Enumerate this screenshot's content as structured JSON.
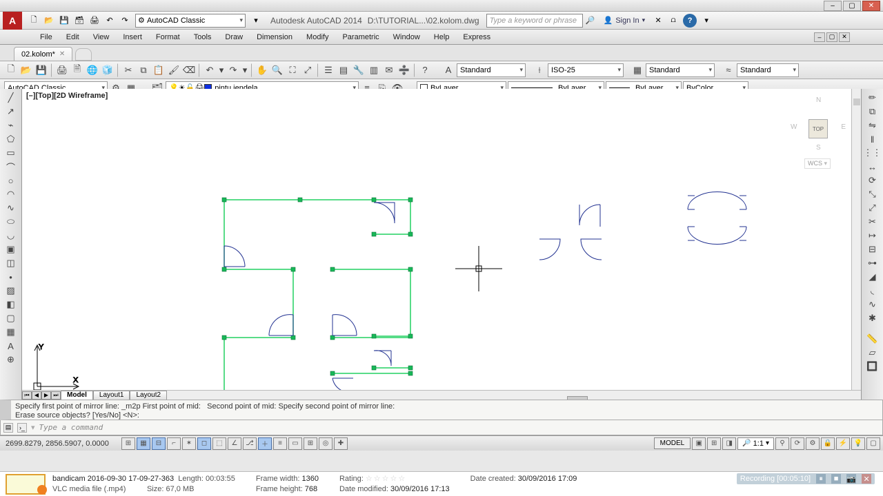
{
  "window": {
    "app_title": "Autodesk AutoCAD 2014",
    "file_title": "D:\\TUTORIAL...\\02.kolom.dwg",
    "search_placeholder": "Type a keyword or phrase",
    "signin": "Sign In"
  },
  "workspace": {
    "current": "AutoCAD Classic",
    "current2": "AutoCAD Classic"
  },
  "menu": [
    "File",
    "Edit",
    "View",
    "Insert",
    "Format",
    "Tools",
    "Draw",
    "Dimension",
    "Modify",
    "Parametric",
    "Window",
    "Help",
    "Express"
  ],
  "doc_tab": {
    "name": "02.kolom*"
  },
  "styles": {
    "text": "Standard",
    "dim": "ISO-25",
    "table": "Standard",
    "ml": "Standard"
  },
  "layer": {
    "current": "pintu jendela",
    "color": "#1030e0"
  },
  "props": {
    "color": "ByLayer",
    "linetype": "ByLayer",
    "lineweight": "ByLayer",
    "plot": "ByColor"
  },
  "viewport": {
    "label": "[–][Top][2D Wireframe]",
    "cube_face": "TOP",
    "cube_dirs": {
      "n": "N",
      "s": "S",
      "e": "E",
      "w": "W"
    },
    "wcs": "WCS"
  },
  "layout_tabs": {
    "model": "Model",
    "l1": "Layout1",
    "l2": "Layout2"
  },
  "command": {
    "hist1": "Specify first point of mirror line: _m2p First point of mid:   Second point of mid: Specify second point of mirror line:",
    "hist2": "Erase source objects? [Yes/No] <N>:",
    "placeholder": "Type a command"
  },
  "status": {
    "coords": "2699.8279, 2856.5907, 0.0000",
    "model": "MODEL",
    "scale": "1:1"
  },
  "explorer": {
    "filename": "bandicam 2016-09-30 17-09-27-363",
    "type": "VLC media file (.mp4)",
    "length_label": "Length:",
    "length": "00:03:55",
    "size_label": "Size:",
    "size": "67,0 MB",
    "fw_label": "Frame width:",
    "fw": "1360",
    "fh_label": "Frame height:",
    "fh": "768",
    "rating_label": "Rating:",
    "dm_label": "Date modified:",
    "dm": "30/09/2016 17:13",
    "dc_label": "Date created:",
    "dc": "30/09/2016 17:09",
    "rec": "Recording [00:05:10]"
  },
  "icons": {
    "new": "🗋",
    "open": "📂",
    "save": "💾",
    "saveall": "🗃",
    "print": "🖨",
    "undo": "↶",
    "redo": "↷",
    "gear": "⚙",
    "min": "–",
    "max": "▢",
    "close": "✕",
    "user": "👤",
    "app": "A",
    "cut": "✂",
    "copy": "⧉",
    "paste": "📋",
    "match": "🖌",
    "erase": "⌫",
    "pan": "✋",
    "zoom": "🔍",
    "zoomw": "⛶",
    "zoome": "⤢",
    "zooma": "▦",
    "sheet": "▤",
    "layer": "🗂",
    "prop": "☰",
    "tool": "🔧",
    "help": "?",
    "line": "╱",
    "xline": "↗",
    "pline": "⌁",
    "poly": "⬠",
    "rect": "▭",
    "arc": "⌒",
    "circ": "○",
    "rev": "◠",
    "spline": "∿",
    "ell": "⬭",
    "ellarc": "◡",
    "ins": "▣",
    "hatch": "▨",
    "grad": "◧",
    "region": "▢",
    "table": "▦",
    "text": "A",
    "pt": "•",
    "move": "↔",
    "rot": "⟳",
    "trim": "✂",
    "ext": "↦",
    "mirror": "⇋",
    "scale": "⤡",
    "stretch": "⤢",
    "fillet": "◟",
    "array": "⋮⋮",
    "off": "‖",
    "explode": "✱",
    "join": "⊶"
  }
}
